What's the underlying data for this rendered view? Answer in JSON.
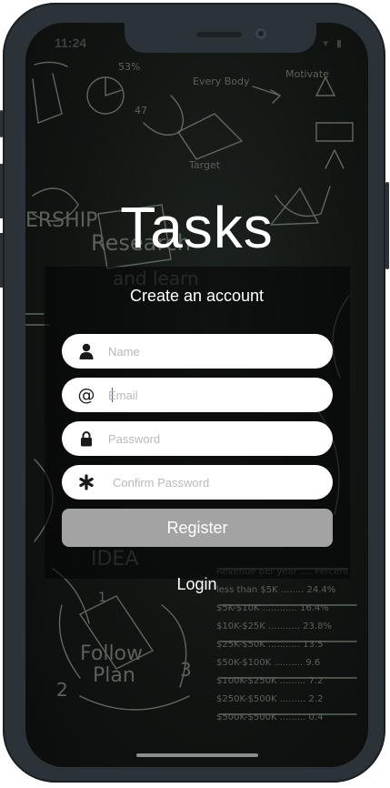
{
  "status_bar": {
    "time": "11:24",
    "icons": "▾ ▮"
  },
  "app": {
    "title": "Tasks",
    "subtitle": "Create an account"
  },
  "form": {
    "name": {
      "placeholder": "Name",
      "value": "",
      "icon": "person-icon"
    },
    "email": {
      "placeholder": "Email",
      "value": "",
      "icon": "at-sign-icon"
    },
    "password": {
      "placeholder": "Password",
      "value": "",
      "icon": "lock-icon"
    },
    "confirm_password": {
      "placeholder": "Confirm Password",
      "value": "",
      "icon": "asterisk-icon"
    },
    "register_label": "Register",
    "login_label": "Login"
  },
  "colors": {
    "background": "#111512",
    "field": "#ffffff",
    "register_button": "#a3a3a3",
    "text": "#ffffff",
    "device_frame": "#2c3338"
  }
}
